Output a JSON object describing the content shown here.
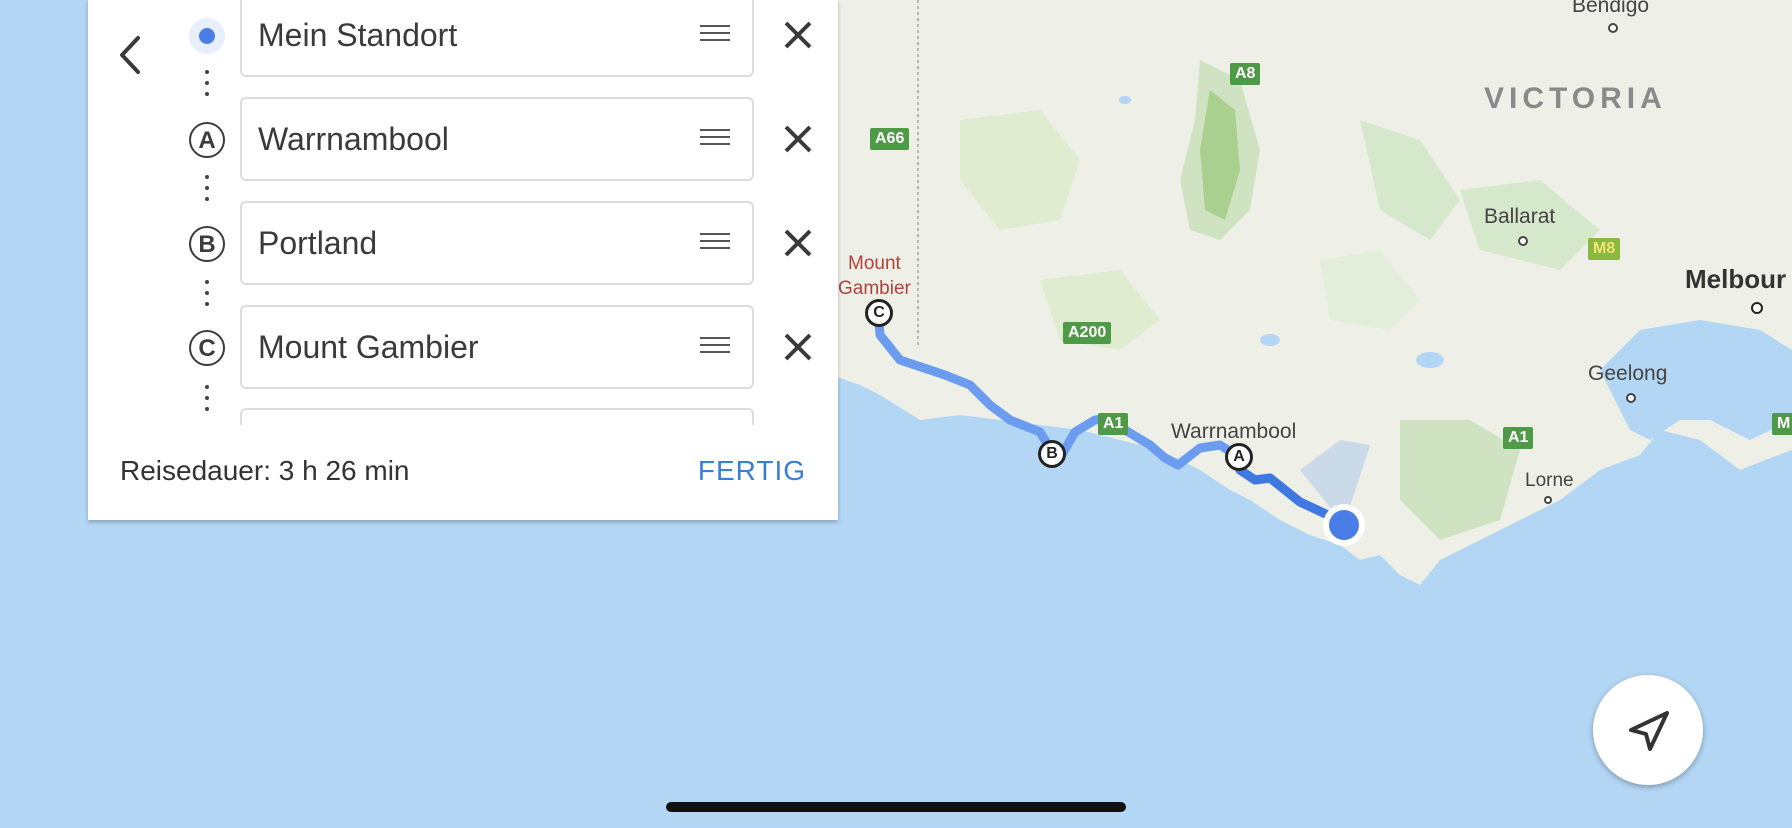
{
  "directions": {
    "stops": [
      {
        "marker": "location",
        "label": "Mein Standort"
      },
      {
        "marker": "A",
        "label": "Warrnambool"
      },
      {
        "marker": "B",
        "label": "Portland"
      },
      {
        "marker": "C",
        "label": "Mount Gambier"
      }
    ],
    "duration": "Reisedauer: 3 h 26 min",
    "done_label": "FERTIG"
  },
  "map": {
    "region_label": "VICTORIA",
    "cities": {
      "bendigo": "Bendigo",
      "ballarat": "Ballarat",
      "melbourne": "Melbour",
      "geelong": "Geelong",
      "lorne": "Lorne",
      "warrnambool": "Warrnambool",
      "mount_gambier_line1": "Mount",
      "mount_gambier_line2": "Gambier"
    },
    "roads": {
      "a8": "A8",
      "a66": "A66",
      "a200": "A200",
      "a1_west": "A1",
      "a1_east": "A1",
      "m8": "M8",
      "m_edge": "M"
    },
    "waypoints": {
      "a": "A",
      "b": "B",
      "c": "C"
    }
  },
  "colors": {
    "water": "#b3d6f5",
    "land": "#eef0e8",
    "route": "#6b9cf0",
    "accent": "#3a7fd5",
    "location_dot": "#4a7ee6"
  }
}
